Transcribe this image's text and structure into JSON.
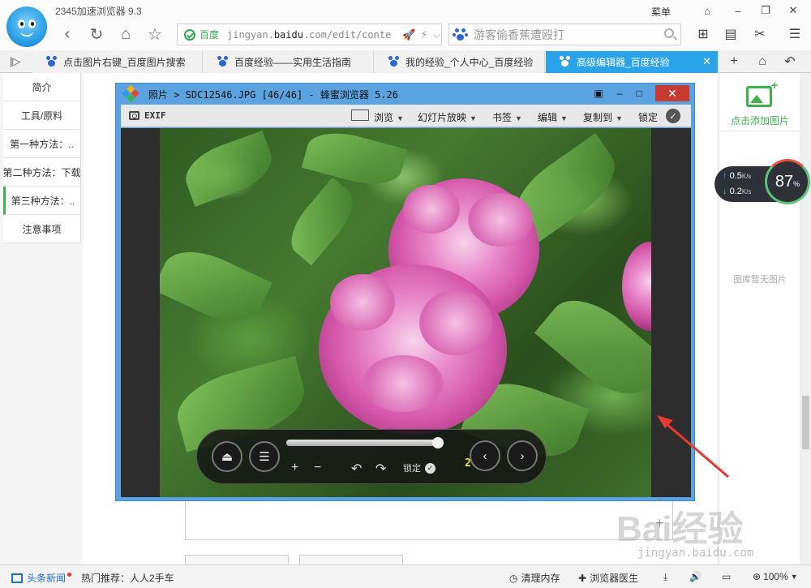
{
  "browser": {
    "app_title": "2345加速浏览器 9.3",
    "menu_label": "菜单",
    "address": {
      "site_label": "百度",
      "url_prefix": "jingyan.",
      "url_domain": "baidu",
      "url_suffix": ".com/edit/conte"
    },
    "search": {
      "placeholder": "游客偷香蕉遭殴打"
    }
  },
  "tabs": [
    {
      "label": "点击图片右键_百度图片搜索",
      "active": false
    },
    {
      "label": "百度经验——实用生活指南",
      "active": false
    },
    {
      "label": "我的经验_个人中心_百度经验",
      "active": false
    },
    {
      "label": "高级编辑器_百度经验",
      "active": true
    }
  ],
  "left_nav": [
    "简介",
    "工具/原料",
    "第一种方法：..",
    "第二种方法：下载",
    "第三种方法：..",
    "注意事项"
  ],
  "right_panel": {
    "add_image_label": "点击添加图片",
    "empty_label": "图库暂无图片"
  },
  "speed_widget": {
    "upload": "0.5",
    "download": "0.2",
    "unit": "K/s",
    "percent": "87",
    "percent_unit": "%"
  },
  "viewer": {
    "title": "照片 > SDC12546.JPG [46/46] - 蜂蜜浏览器 5.26",
    "exif_label": "EXIF",
    "menus": {
      "browse": "浏览",
      "slideshow": "幻灯片放映",
      "bookmark": "书签",
      "edit": "编辑",
      "copy_to": "复制到",
      "lock": "锁定"
    },
    "player": {
      "lock_label": "锁定",
      "counter": "2? 36",
      "progress_fraction": 0.98
    }
  },
  "watermark": {
    "text": "Bai经验",
    "sub": "jingyan.baidu.com"
  },
  "statusbar": {
    "news_label": "头条新闻",
    "hot_label": "热门推荐：人人2手车",
    "clean_memory": "清理内存",
    "doctor": "浏览器医生",
    "zoom": "100%"
  }
}
